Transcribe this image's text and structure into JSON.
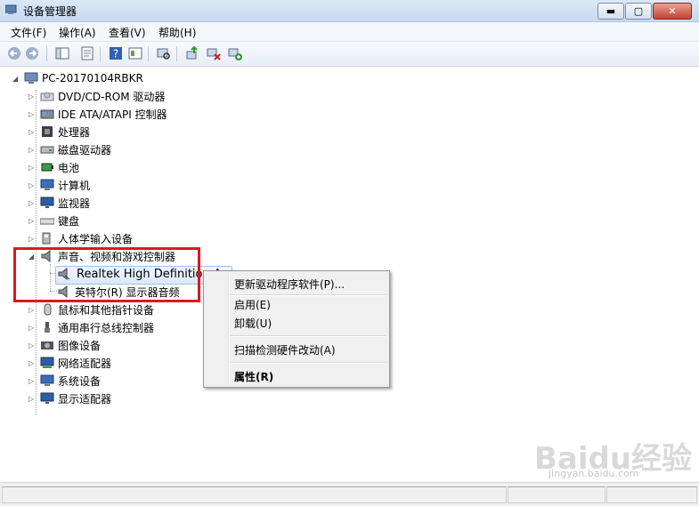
{
  "window": {
    "title": "设备管理器"
  },
  "window_buttons": {
    "minimize": "▬",
    "maximize": "▢",
    "close": "✕"
  },
  "menu": [
    "文件(F)",
    "操作(A)",
    "查看(V)",
    "帮助(H)"
  ],
  "tree": {
    "root": "PC-20170104RBKR",
    "items": [
      {
        "label": "DVD/CD-ROM 驱动器",
        "icon": "dvd-drive-icon"
      },
      {
        "label": "IDE ATA/ATAPI 控制器",
        "icon": "ide-controller-icon"
      },
      {
        "label": "处理器",
        "icon": "processor-icon"
      },
      {
        "label": "磁盘驱动器",
        "icon": "disk-drive-icon"
      },
      {
        "label": "电池",
        "icon": "battery-icon"
      },
      {
        "label": "计算机",
        "icon": "computer-icon"
      },
      {
        "label": "监视器",
        "icon": "monitor-icon"
      },
      {
        "label": "键盘",
        "icon": "keyboard-icon"
      },
      {
        "label": "人体学输入设备",
        "icon": "hid-icon"
      },
      {
        "label": "声音、视频和游戏控制器",
        "icon": "speaker-icon"
      },
      {
        "label": "Realtek High Definition A",
        "icon": "speaker-disabled-icon"
      },
      {
        "label": "英特尔(R) 显示器音频",
        "icon": "speaker-icon"
      },
      {
        "label": "鼠标和其他指针设备",
        "icon": "mouse-icon"
      },
      {
        "label": "通用串行总线控制器",
        "icon": "usb-icon"
      },
      {
        "label": "图像设备",
        "icon": "camera-icon"
      },
      {
        "label": "网络适配器",
        "icon": "network-adapter-icon"
      },
      {
        "label": "系统设备",
        "icon": "system-device-icon"
      },
      {
        "label": "显示适配器",
        "icon": "display-adapter-icon"
      }
    ]
  },
  "context_menu": {
    "update_driver": "更新驱动程序软件(P)...",
    "enable": "启用(E)",
    "uninstall": "卸载(U)",
    "scan": "扫描检测硬件改动(A)",
    "properties": "属性(R)"
  },
  "watermark": {
    "main": "Baidu经验",
    "sub": "jingyan.baidu.com"
  },
  "colors": {
    "highlight": "#e0161f",
    "selection": "#dbe8f8"
  }
}
